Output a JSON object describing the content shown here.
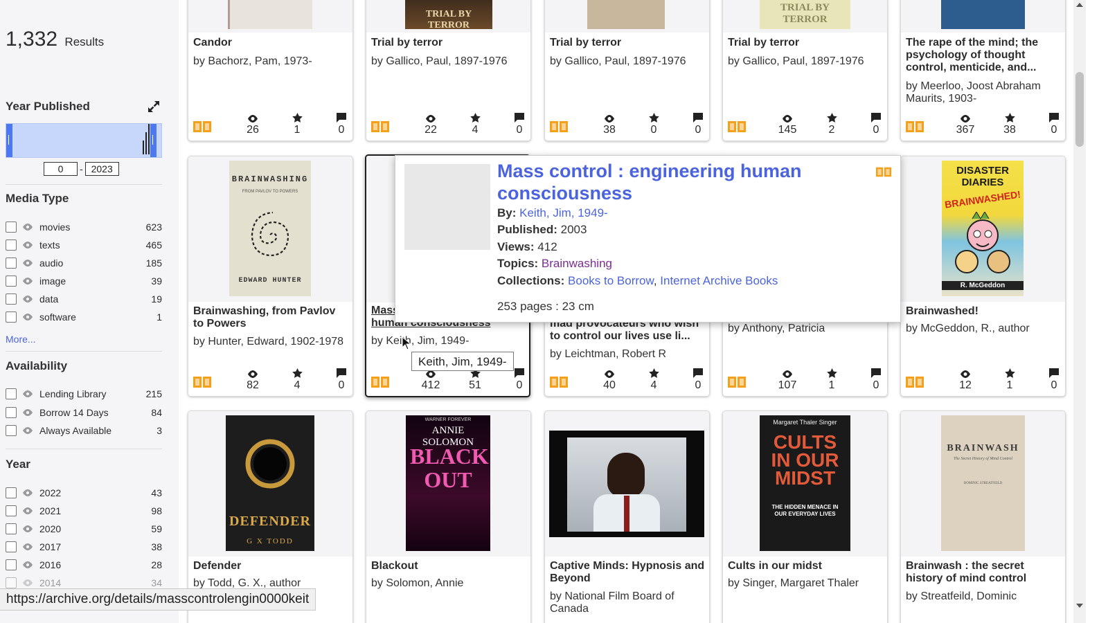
{
  "sidebar": {
    "results_count": "1,332",
    "results_label": "Results",
    "year_published": {
      "title": "Year Published",
      "min": "0",
      "max": "2023",
      "separator": "-"
    },
    "media_type": {
      "title": "Media Type",
      "items": [
        {
          "label": "movies",
          "count": "623"
        },
        {
          "label": "texts",
          "count": "465"
        },
        {
          "label": "audio",
          "count": "185"
        },
        {
          "label": "image",
          "count": "39"
        },
        {
          "label": "data",
          "count": "19"
        },
        {
          "label": "software",
          "count": "1"
        }
      ],
      "more": "More..."
    },
    "availability": {
      "title": "Availability",
      "items": [
        {
          "label": "Lending Library",
          "count": "215"
        },
        {
          "label": "Borrow 14 Days",
          "count": "84"
        },
        {
          "label": "Always Available",
          "count": "3"
        }
      ]
    },
    "year": {
      "title": "Year",
      "items": [
        {
          "label": "2022",
          "count": "43"
        },
        {
          "label": "2021",
          "count": "98"
        },
        {
          "label": "2020",
          "count": "59"
        },
        {
          "label": "2017",
          "count": "38"
        },
        {
          "label": "2016",
          "count": "28"
        },
        {
          "label": "2014",
          "count": "34"
        }
      ]
    }
  },
  "cards": [
    {
      "title": "Candor",
      "by": "by Bachorz, Pam, 1973-",
      "views": "26",
      "favs": "1",
      "reviews": "0"
    },
    {
      "title": "Trial by terror",
      "by": "by Gallico, Paul, 1897-1976",
      "views": "22",
      "favs": "4",
      "reviews": "0",
      "cover_text": "TRIAL BY TERROR"
    },
    {
      "title": "Trial by terror",
      "by": "by Gallico, Paul, 1897-1976",
      "views": "38",
      "favs": "0",
      "reviews": "0"
    },
    {
      "title": "Trial by terror",
      "by": "by Gallico, Paul, 1897-1976",
      "views": "145",
      "favs": "2",
      "reviews": "0",
      "cover_text": "TRIAL BY TERROR"
    },
    {
      "title": "The rape of the mind; the psychology of thought control, menticide, and...",
      "by": "by Meerloo, Joost Abraham Maurits, 1903-",
      "views": "367",
      "favs": "38",
      "reviews": "0"
    },
    {
      "title": "Brainwashing, from Pavlov to Powers",
      "by": "by Hunter, Edward, 1902-1978",
      "views": "82",
      "favs": "4",
      "reviews": "0",
      "cover_text": "BRAINWASHING",
      "cover_sub": "FROM PAVLOV TO POWERS",
      "cover_author": "EDWARD HUNTER"
    },
    {
      "title": "Mass control : engineering human consciousness",
      "title_visible_1": "Mass",
      "title_visible_2": "human consciousness",
      "by": "by Keith, Jim, 1949-",
      "views": "412",
      "favs": "51",
      "reviews": "0"
    },
    {
      "title_fragment_1": "mad provocateurs who wish",
      "title_fragment_2": "to control our lives use li...",
      "by": "by Leichtman, Robert R",
      "views": "40",
      "favs": "4",
      "reviews": "0"
    },
    {
      "by": "by Anthony, Patricia",
      "views": "107",
      "favs": "1",
      "reviews": "0"
    },
    {
      "title": "Brainwashed!",
      "by": "by McGeddon, R., author",
      "views": "12",
      "favs": "1",
      "reviews": "0",
      "cover_text": "DISASTER DIARIES",
      "cover_sub": "BRAINWASHED!",
      "cover_author": "R. McGeddon"
    },
    {
      "title": "Defender",
      "by": "by Todd, G. X., author",
      "cover_text": "DEFENDER",
      "cover_author": "G X TODD"
    },
    {
      "title": "Blackout",
      "by": "by Solomon, Annie",
      "cover_author": "ANNIE SOLOMON",
      "cover_text": "BLACK OUT",
      "cover_publisher": "WARNER FOREVER"
    },
    {
      "title": "Captive Minds: Hypnosis and Beyond",
      "by": "by National Film Board of Canada"
    },
    {
      "title": "Cults in our midst",
      "by": "by Singer, Margaret Thaler",
      "cover_author": "Margaret Thaler Singer",
      "cover_text": "CULTS IN OUR MIDST",
      "cover_sub": "THE HIDDEN MENACE IN OUR EVERYDAY LIVES"
    },
    {
      "title": "Brainwash : the secret history of mind control",
      "by": "by Streatfeild, Dominic",
      "cover_text": "BRAINWASH",
      "cover_sub": "The Secret History of Mind Control",
      "cover_author": "DOMINIC STREATFEILD"
    }
  ],
  "popup": {
    "title": "Mass control : engineering human consciousness",
    "by_label": "By:",
    "by_value": "Keith, Jim, 1949-",
    "published_label": "Published:",
    "published_value": "2003",
    "views_label": "Views:",
    "views_value": "412",
    "topics_label": "Topics:",
    "topics_value": "Brainwashing",
    "collections_label": "Collections:",
    "collection_1": "Books to Borrow",
    "collection_sep": ",",
    "collection_2": "Internet Archive Books",
    "extent": "253 pages : 23 cm"
  },
  "tooltip": "Keith, Jim, 1949-",
  "status_url": "https://archive.org/details/masscontrolengin0000keit",
  "colors": {
    "accent": "#4b64de",
    "range_fill": "#c7d6fb",
    "range_handle": "#4d78f0",
    "topic": "#7b2e91",
    "texts_icon": "#f5a01a"
  }
}
